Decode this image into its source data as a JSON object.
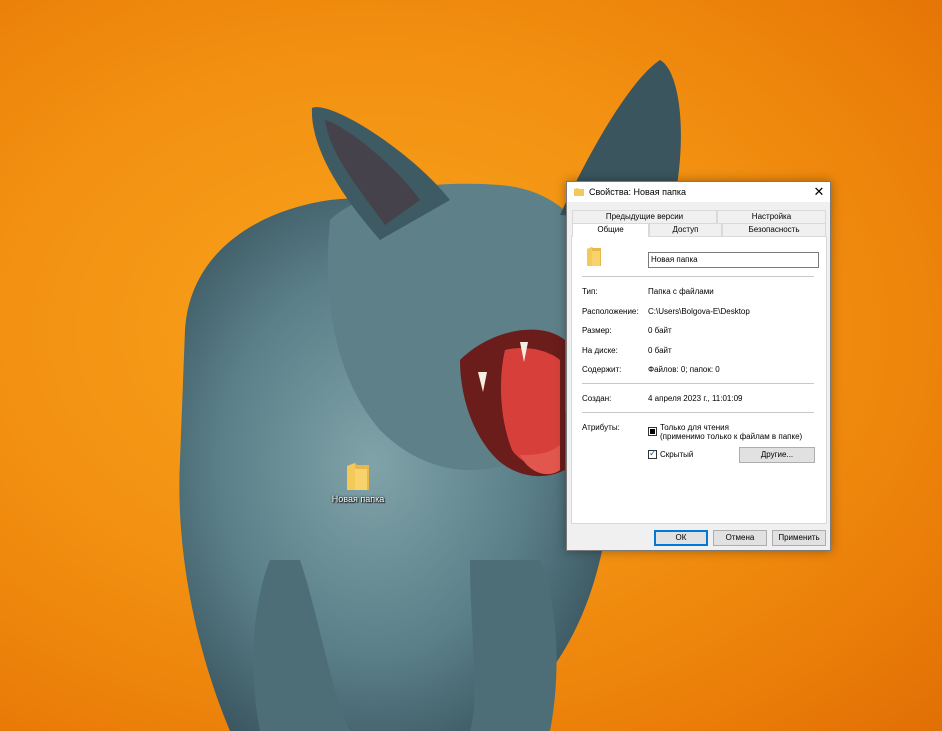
{
  "desktop": {
    "icon_label": "Новая папка"
  },
  "dialog": {
    "title": "Свойства: Новая папка",
    "close_glyph": "✕",
    "tabs_back": [
      "Предыдущие версии",
      "Настройка"
    ],
    "tabs_front": [
      "Общие",
      "Доступ",
      "Безопасность"
    ],
    "active_tab": "Общие",
    "folder_name": "Новая папка",
    "rows": [
      {
        "label": "Тип:",
        "value": "Папка с файлами"
      },
      {
        "label": "Расположение:",
        "value": "C:\\Users\\Bolgova-E\\Desktop"
      },
      {
        "label": "Размер:",
        "value": "0 байт"
      },
      {
        "label": "На диске:",
        "value": "0 байт"
      },
      {
        "label": "Содержит:",
        "value": "Файлов: 0; папок: 0"
      }
    ],
    "created": {
      "label": "Создан:",
      "value": "4 апреля 2023 г., 11:01:09"
    },
    "attributes": {
      "label": "Атрибуты:",
      "readonly_line1": "Только для чтения",
      "readonly_line2": "(применимо только к файлам в папке)",
      "hidden_label": "Скрытый",
      "other_button": "Другие..."
    },
    "buttons": {
      "ok": "ОК",
      "cancel": "Отмена",
      "apply": "Применить"
    }
  },
  "colors": {
    "background_orange": "#f39212",
    "folder_yellow": "#f8d36b",
    "accent_blue": "#0078d7"
  }
}
